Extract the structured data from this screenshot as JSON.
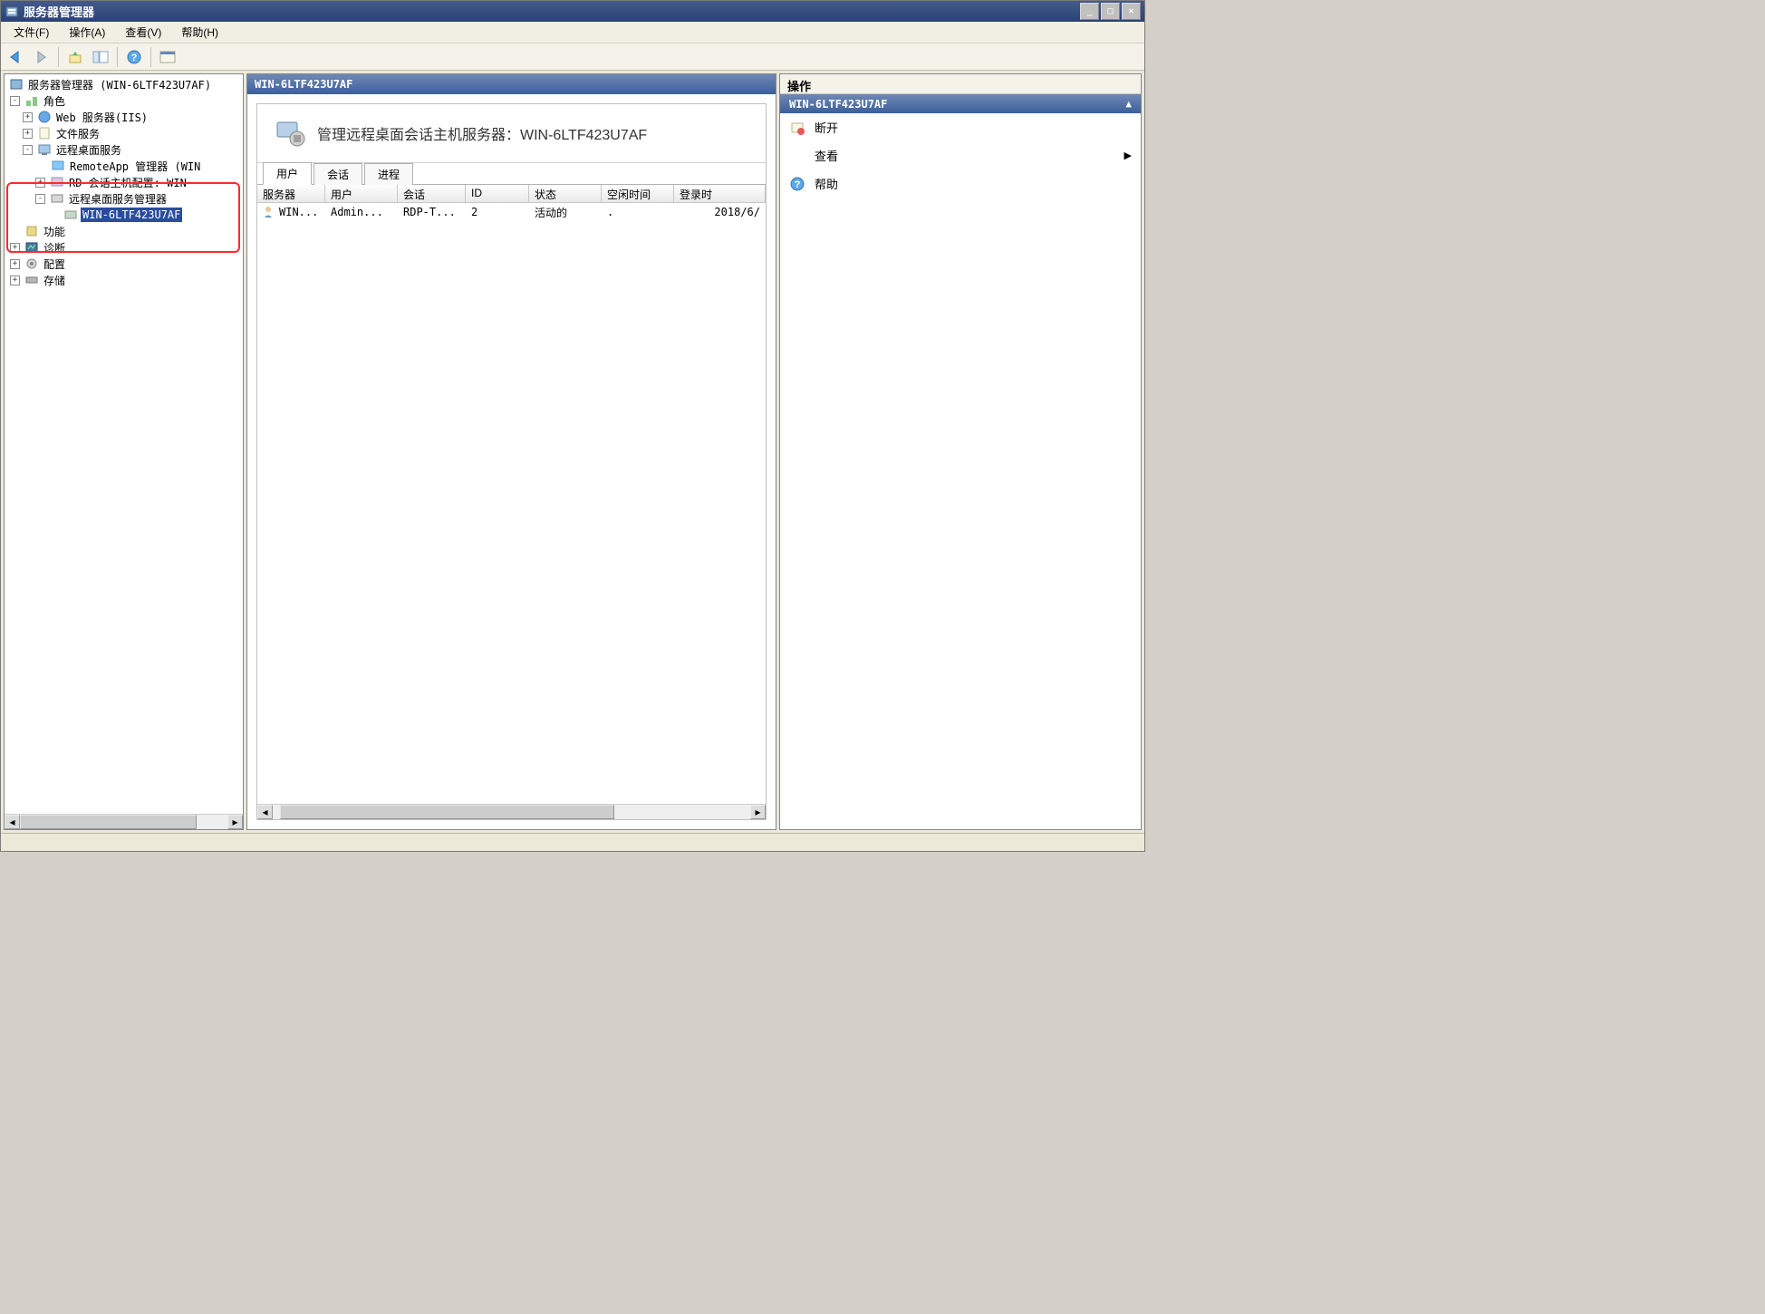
{
  "window": {
    "title": "服务器管理器"
  },
  "menu": {
    "file": "文件(F)",
    "action": "操作(A)",
    "view": "查看(V)",
    "help": "帮助(H)"
  },
  "tree": {
    "root": "服务器管理器 (WIN-6LTF423U7AF)",
    "roles": "角色",
    "iis": "Web 服务器(IIS)",
    "file_services": "文件服务",
    "rds": "远程桌面服务",
    "remoteapp": "RemoteApp 管理器 (WIN",
    "rd_host_cfg": "RD 会话主机配置: WIN-",
    "rds_mgr": "远程桌面服务管理器",
    "server_node": "WIN-6LTF423U7AF",
    "features": "功能",
    "diagnostics": "诊断",
    "configuration": "配置",
    "storage": "存储"
  },
  "center": {
    "header": "WIN-6LTF423U7AF",
    "banner": "管理远程桌面会话主机服务器：WIN-6LTF423U7AF",
    "tabs": {
      "users": "用户",
      "sessions": "会话",
      "processes": "进程"
    },
    "columns": {
      "server": "服务器",
      "user": "用户",
      "session": "会话",
      "id": "ID",
      "status": "状态",
      "idle": "空闲时间",
      "logon": "登录时"
    },
    "row": {
      "server": "WIN...",
      "user": "Admin...",
      "session": "RDP-T...",
      "id": "2",
      "status": "活动的",
      "idle": ".",
      "logon": "2018/6/"
    }
  },
  "actions": {
    "title": "操作",
    "subheader": "WIN-6LTF423U7AF",
    "disconnect": "断开",
    "view": "查看",
    "help": "帮助"
  }
}
